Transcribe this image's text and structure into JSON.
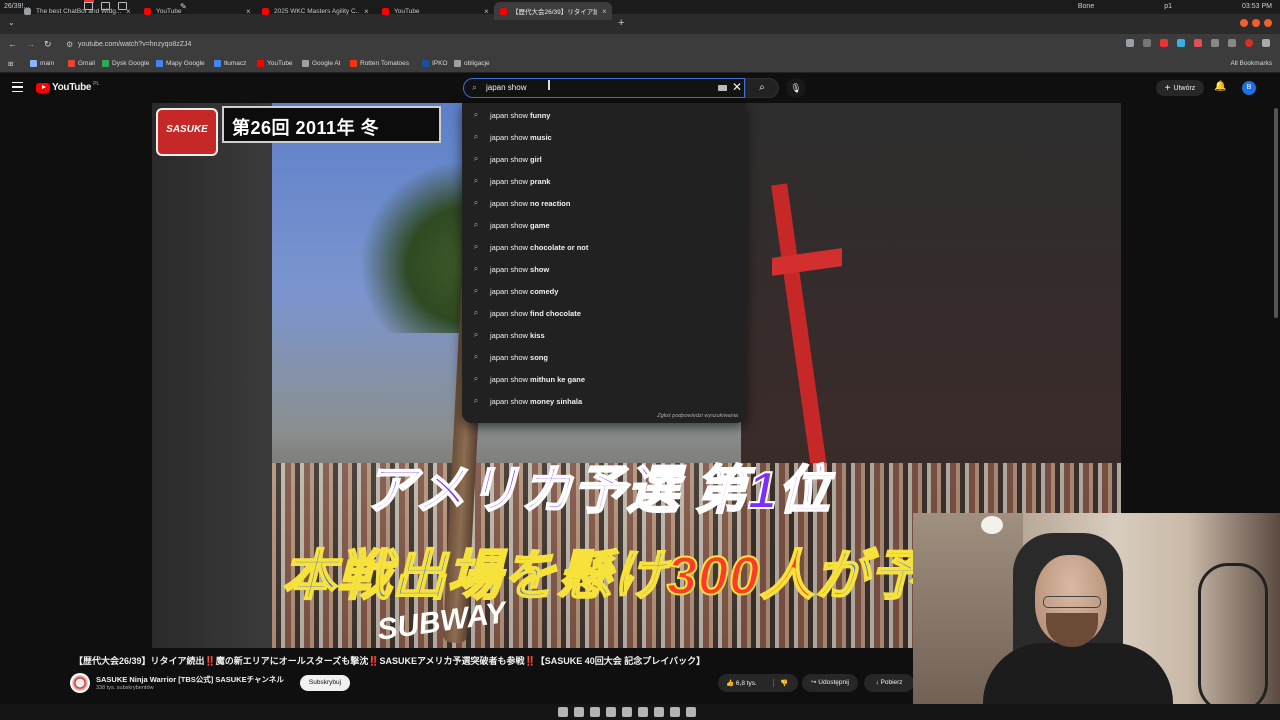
{
  "os_bar": {
    "workspace": "26/39!...",
    "right_items": [
      "Bone",
      "p1",
      "03:53 PM"
    ]
  },
  "tabs": [
    {
      "label": "The best ChatBot and Widg...",
      "close": "×",
      "favicon_color": "#9aa0a6",
      "active": false
    },
    {
      "label": "YouTube",
      "close": "×",
      "favicon_color": "#ff0000",
      "active": false
    },
    {
      "label": "2025 WKC Masters Agility C...",
      "close": "×",
      "favicon_color": "#ff0000",
      "active": false
    },
    {
      "label": "YouTube",
      "close": "×",
      "favicon_color": "#ff0000",
      "active": false
    },
    {
      "label": "【歴代大会26/39】リタイア続出...",
      "close": "×",
      "favicon_color": "#ff0000",
      "active": true
    }
  ],
  "new_tab": "+",
  "address_bar": {
    "url": "youtube.com/watch?v=hnzyqo8zZJ4"
  },
  "bookmarks": [
    {
      "label": "main",
      "icon_color": "#8ab4f8"
    },
    {
      "label": "Gmail",
      "icon_color": "#ea4335"
    },
    {
      "label": "Dysk Google",
      "icon_color": "#34a853"
    },
    {
      "label": "Mapy Google",
      "icon_color": "#4285f4"
    },
    {
      "label": "tłumacz",
      "icon_color": "#4285f4"
    },
    {
      "label": "YouTube",
      "icon_color": "#ff0000"
    },
    {
      "label": "Google AI",
      "icon_color": "#9aa0a6"
    },
    {
      "label": "Rotten Tomatoes",
      "icon_color": "#fa320a"
    },
    {
      "label": "IPKO",
      "icon_color": "#1a4f9c"
    },
    {
      "label": "obligacje",
      "icon_color": "#9aa0a6"
    }
  ],
  "all_bookmarks": "All Bookmarks",
  "youtube": {
    "logo_text": "YouTube",
    "logo_region": "PL",
    "search_value": "japan show",
    "create_label": "Utwórz",
    "avatar_letter": "B"
  },
  "suggestions": {
    "prefix": "japan show",
    "items": [
      " funny",
      " music",
      " girl",
      " prank",
      " no reaction",
      " game",
      " chocolate or not",
      " show",
      " comedy",
      " find chocolate",
      " kiss",
      " song",
      " mithun ke gane",
      " money sinhala"
    ],
    "report": "Zgłoś podpowiedzi wyszukiwania"
  },
  "video_overlay": {
    "title_box": "第26回 2011年 冬",
    "logo": "SASUKE",
    "caption1": "アメリカ予選 第1位",
    "caption2_a": "本戦出場を懸け",
    "caption2_b": "300人",
    "caption2_c": "が予選に参",
    "sign": "SUBWAY"
  },
  "video_info": {
    "title": "【歴代大会26/39】リタイア続出‼️魔の新エリアにオールスターズも撃沈‼️SASUKEアメリカ予選突破者も参戦‼️【SASUKE 40回大会 記念プレイバック】",
    "channel": "SASUKE Ninja Warrior [TBS公式] SASUKEチャンネル",
    "subscribers": "338 tys. subskrybentów",
    "subscribe": "Subskrybuj",
    "likes": "6,8 tys.",
    "share": "Udostępnij",
    "download": "Pobierz"
  }
}
